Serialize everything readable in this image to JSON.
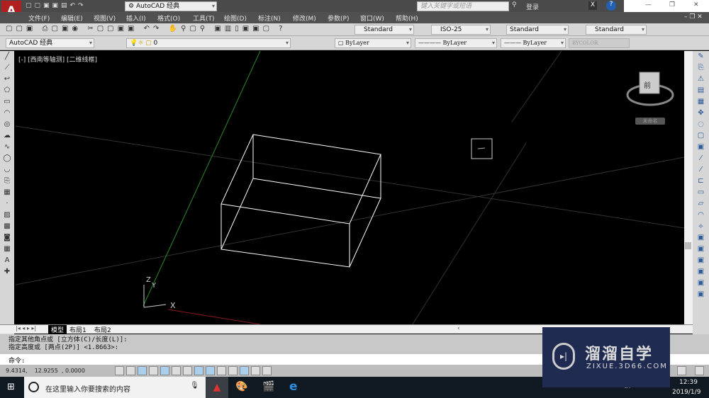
{
  "title_bar": {
    "workspace": "AutoCAD 经典",
    "search_placeholder": "键入关键字或短语",
    "login": "登录"
  },
  "menu": [
    "文件(F)",
    "编辑(E)",
    "视图(V)",
    "插入(I)",
    "格式(O)",
    "工具(T)",
    "绘图(D)",
    "标注(N)",
    "修改(M)",
    "参数(P)",
    "窗口(W)",
    "帮助(H)"
  ],
  "styles": {
    "text_style": "Standard",
    "dim_style": "ISO-25",
    "table_style": "Standard",
    "multileader_style": "Standard"
  },
  "layers": {
    "workspace": "AutoCAD 经典",
    "current_layer": "0",
    "color": "ByLayer",
    "linetype": "ByLayer",
    "lineweight": "ByLayer",
    "plotstyle": "BYCOLOR"
  },
  "viewport": {
    "label": "[-] [西南等轴测] [二维线框]",
    "viewcube_face": "前",
    "wcs_label": "未命名",
    "ucs_x": "X",
    "ucs_y": "Y",
    "ucs_z": "Z",
    "colors": {
      "y_axis": "#2a8a2a",
      "x_axis": "#a02020",
      "wire": "#ffffff"
    }
  },
  "tabs": [
    "模型",
    "布局1",
    "布局2"
  ],
  "command": {
    "history": [
      "指定其他角点或 [立方体(C)/长度(L)]:",
      "指定高度或 [两点(2P)] <1.8663>:"
    ],
    "prompt": "命令:"
  },
  "status": {
    "coords": "9.4314,    12.9255  , 0.0000"
  },
  "taskbar": {
    "search_placeholder": "在这里输入你要搜索的内容",
    "time": "12:39",
    "date": "2019/1/9"
  },
  "watermark": {
    "brand": "溜溜自学",
    "url": "ZIXUE.3D66.COM"
  }
}
